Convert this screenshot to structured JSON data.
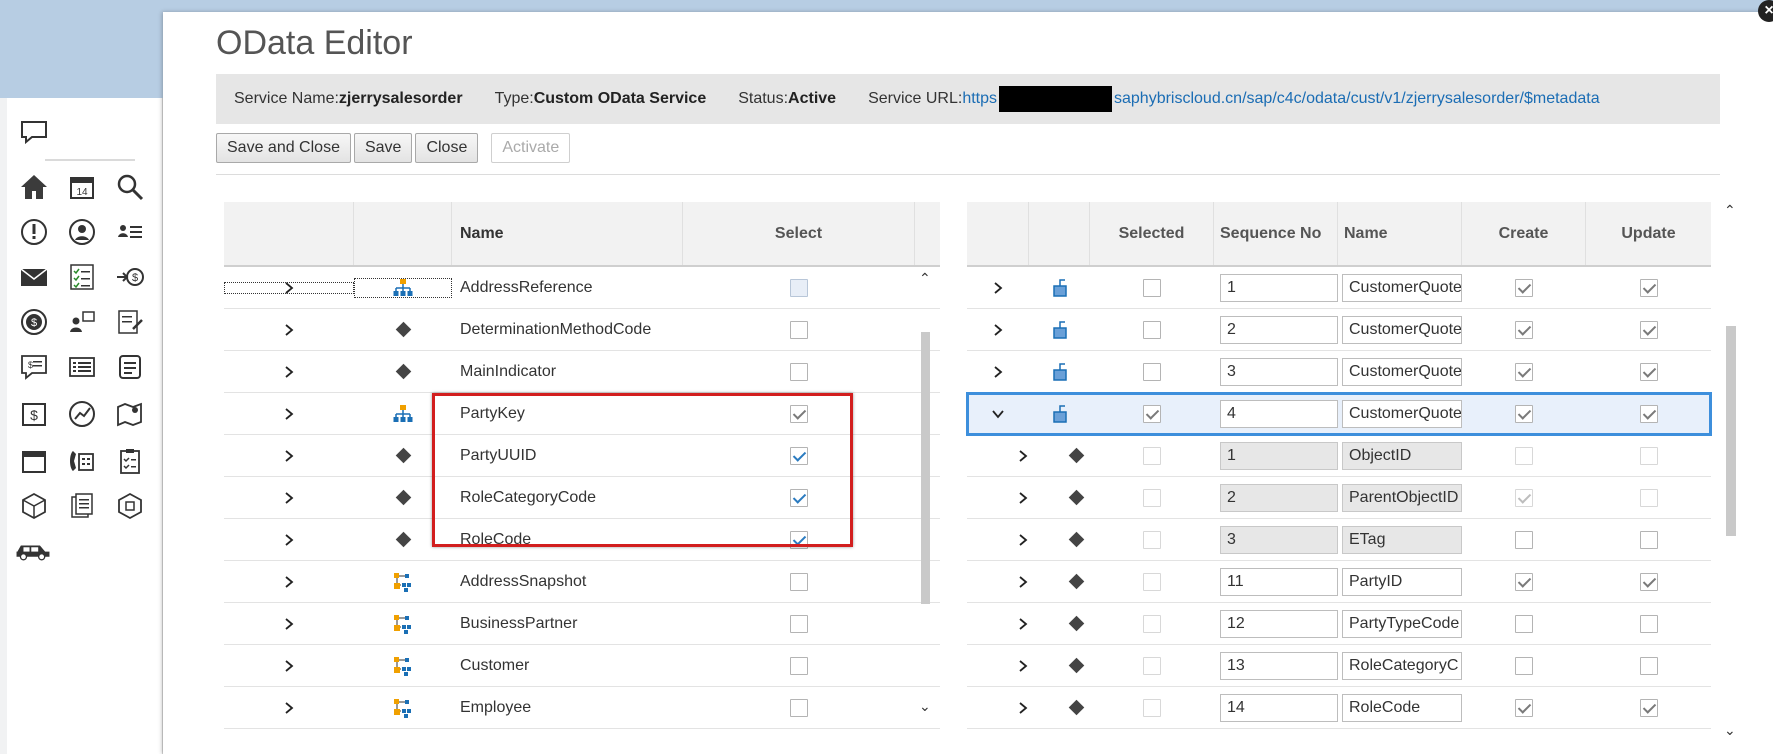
{
  "dialog": {
    "title": "OData Editor",
    "close_label": "×"
  },
  "info": {
    "service_name_label": "Service Name:",
    "service_name": "zjerrysalesorder",
    "type_label": "Type:",
    "type": "Custom OData Service",
    "status_label": "Status:",
    "status": "Active",
    "url_label": "Service URL:",
    "url_prefix": "https",
    "url_suffix": "saphybriscloud.cn/sap/c4c/odata/cust/v1/zjerrysalesorder/$metadata"
  },
  "toolbar": {
    "save_close": "Save and Close",
    "save": "Save",
    "close": "Close",
    "activate": "Activate"
  },
  "left_table": {
    "headers": {
      "name": "Name",
      "select": "Select"
    },
    "rows": [
      {
        "icon": "hierarchy-icon",
        "name": "AddressReference",
        "checked": false
      },
      {
        "icon": "diamond-icon",
        "name": "DeterminationMethodCode",
        "checked": false
      },
      {
        "icon": "diamond-icon",
        "name": "MainIndicator",
        "checked": false
      },
      {
        "icon": "hierarchy-icon",
        "name": "PartyKey",
        "checked": true
      },
      {
        "icon": "diamond-icon",
        "name": "PartyUUID",
        "checked": true
      },
      {
        "icon": "diamond-icon",
        "name": "RoleCategoryCode",
        "checked": true
      },
      {
        "icon": "diamond-icon",
        "name": "RoleCode",
        "checked": true
      },
      {
        "icon": "association-icon",
        "name": "AddressSnapshot",
        "checked": false
      },
      {
        "icon": "association-icon",
        "name": "BusinessPartner",
        "checked": false
      },
      {
        "icon": "association-icon",
        "name": "Customer",
        "checked": false
      },
      {
        "icon": "association-icon",
        "name": "Employee",
        "checked": false
      }
    ]
  },
  "right_table": {
    "headers": {
      "selected": "Selected",
      "sequence": "Sequence No",
      "name": "Name",
      "create": "Create",
      "update": "Update"
    },
    "rows": [
      {
        "level": 0,
        "expanded": false,
        "seq": "1",
        "name": "CustomerQuote",
        "selected": false
      },
      {
        "level": 0,
        "expanded": false,
        "seq": "2",
        "name": "CustomerQuote",
        "selected": false
      },
      {
        "level": 0,
        "expanded": false,
        "seq": "3",
        "name": "CustomerQuote",
        "selected": false
      },
      {
        "level": 0,
        "expanded": true,
        "seq": "4",
        "name": "CustomerQuote",
        "selected": true
      },
      {
        "level": 1,
        "seq": "1",
        "name": "ObjectID",
        "readonly": true
      },
      {
        "level": 1,
        "seq": "2",
        "name": "ParentObjectID",
        "readonly": true
      },
      {
        "level": 1,
        "seq": "3",
        "name": "ETag",
        "readonly": true
      },
      {
        "level": 1,
        "seq": "11",
        "name": "PartyID",
        "readonly": false
      },
      {
        "level": 1,
        "seq": "12",
        "name": "PartyTypeCode",
        "readonly": false
      },
      {
        "level": 1,
        "seq": "13",
        "name": "RoleCategoryC",
        "readonly": false
      },
      {
        "level": 1,
        "seq": "14",
        "name": "RoleCode",
        "readonly": false
      }
    ]
  }
}
